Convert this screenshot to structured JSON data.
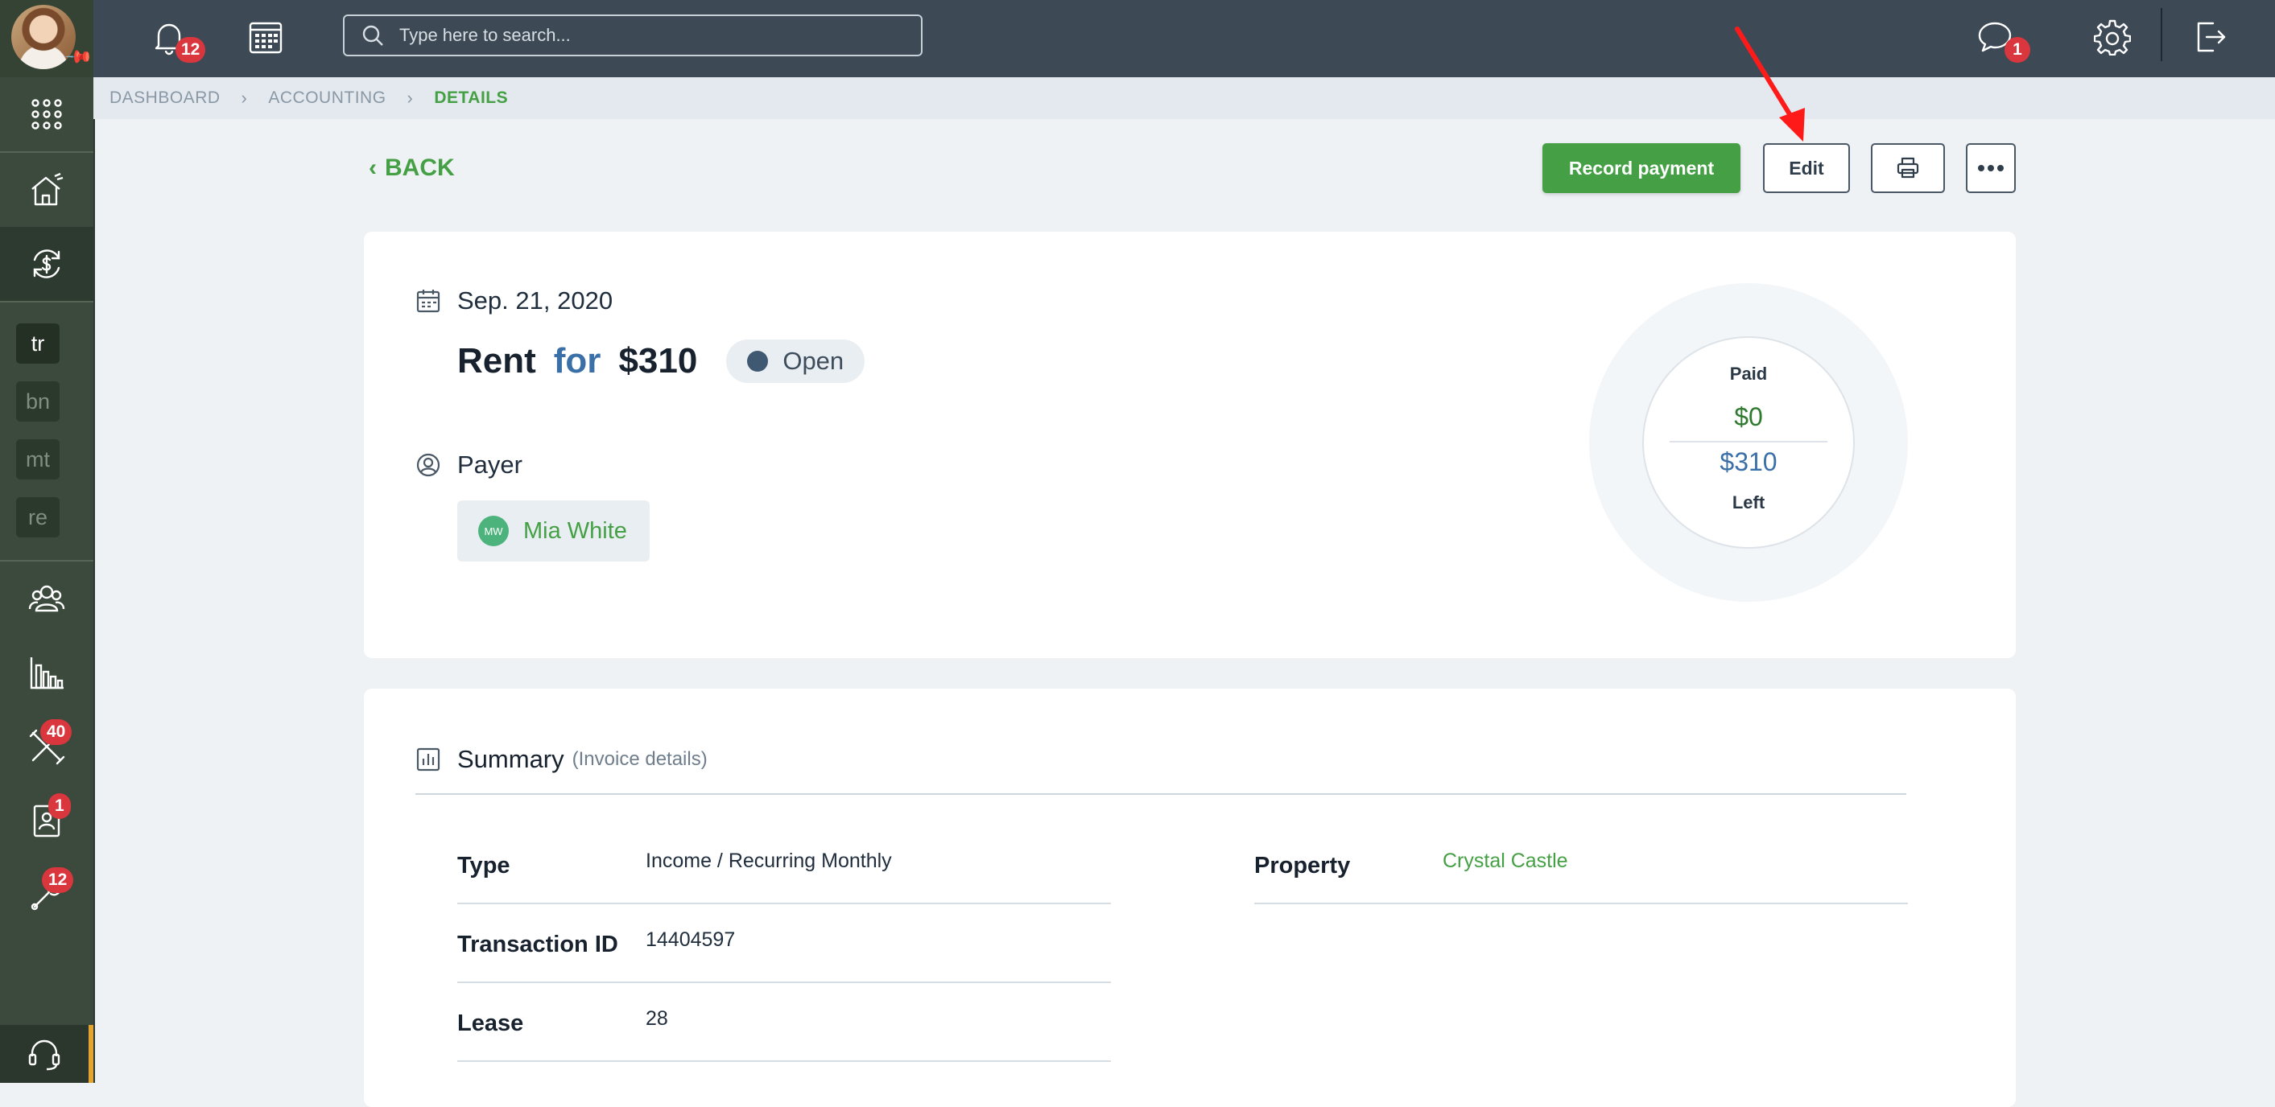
{
  "header": {
    "notifications_count": "12",
    "messages_count": "1",
    "search": {
      "placeholder": "Type here to search..."
    }
  },
  "sidebar": {
    "letters": [
      "tr",
      "bn",
      "mt",
      "re"
    ],
    "badges": {
      "maintenance": "40",
      "tenants": "1",
      "tools": "12"
    }
  },
  "breadcrumb": [
    "DASHBOARD",
    "ACCOUNTING",
    "DETAILS"
  ],
  "actions": {
    "back_label": "BACK",
    "record_payment": "Record payment",
    "edit": "Edit"
  },
  "transaction": {
    "date": "Sep. 21, 2020",
    "category": "Rent",
    "for_word": "for",
    "amount": "$310",
    "status": "Open",
    "payer_heading": "Payer",
    "payer_initials": "MW",
    "payer_name": "Mia White"
  },
  "payment_summary": {
    "paid_label": "Paid",
    "paid_amount": "$0",
    "left_amount": "$310",
    "left_label": "Left"
  },
  "summary": {
    "title": "Summary",
    "subtitle": "(Invoice details)",
    "rows": [
      {
        "label": "Type",
        "value": "Income / Recurring Monthly"
      },
      {
        "label": "Transaction ID",
        "value": "14404597"
      },
      {
        "label": "Lease",
        "value": "28"
      }
    ],
    "property": {
      "label": "Property",
      "value": "Crystal Castle"
    }
  },
  "colors": {
    "accent_green": "#45a045",
    "topbar": "#3d4a55",
    "sidebar": "#3b4a3d",
    "badge_red": "#d9363e",
    "link_blue": "#3a6fa8"
  }
}
